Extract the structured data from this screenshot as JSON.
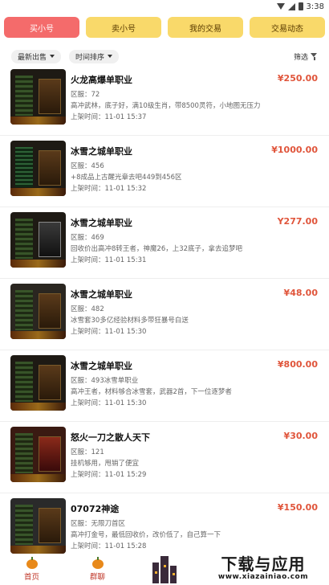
{
  "status_bar": {
    "time": "3:38"
  },
  "tabs": [
    {
      "label": "买小号",
      "active": true
    },
    {
      "label": "卖小号",
      "active": false
    },
    {
      "label": "我的交易",
      "active": false
    },
    {
      "label": "交易动态",
      "active": false
    }
  ],
  "filters": {
    "sort_latest": "最新出售",
    "sort_time": "时间排序",
    "filter": "筛选"
  },
  "listings": [
    {
      "title": "火龙高爆单职业",
      "price": "¥250.00",
      "server": "区服：72",
      "desc": "高冲武林，底子好，满10级生肖，带8500灵符，小地图无压力",
      "time": "上架时间：11-01 15:37"
    },
    {
      "title": "冰雪之城单职业",
      "price": "¥1000.00",
      "server": "区服：456",
      "desc": "+8成品上古醒光章去吧449到456区",
      "time": "上架时间：11-01 15:32"
    },
    {
      "title": "冰雪之城单职业",
      "price": "Y277.00",
      "server": "区服：469",
      "desc": "回收价出高冲8转王者，神魔26，上32底子，拿去追梦吧",
      "time": "上架时间：11-01 15:31"
    },
    {
      "title": "冰雪之城单职业",
      "price": "¥48.00",
      "server": "区服：482",
      "desc": "冰雪套30多亿经验材料多带狂暴号白送",
      "time": "上架时间：11-01 15:30"
    },
    {
      "title": "冰雪之城单职业",
      "price": "¥800.00",
      "server": "区服：493冰雪单职业",
      "desc": "高冲王者，材料够合冰雪套，武器2首，下一位逐梦者",
      "time": "上架时间：11-01 15:30"
    },
    {
      "title": "怒火一刀之散人天下",
      "price": "¥30.00",
      "server": "区服：121",
      "desc": "挂机够用，甩销了便宜",
      "time": "上架时间：11-01 15:29"
    },
    {
      "title": "07072神途",
      "price": "¥150.00",
      "server": "区服：无限刀首区",
      "desc": "高冲打金号，最低回收价，改价低了，自己算一下",
      "time": "上架时间：11-01 15:28"
    }
  ],
  "bottom_nav": {
    "home": "首页",
    "group_chat": "群聊"
  },
  "watermark": {
    "main": "下载与应用",
    "sub": "www.xiazainiao.com"
  }
}
